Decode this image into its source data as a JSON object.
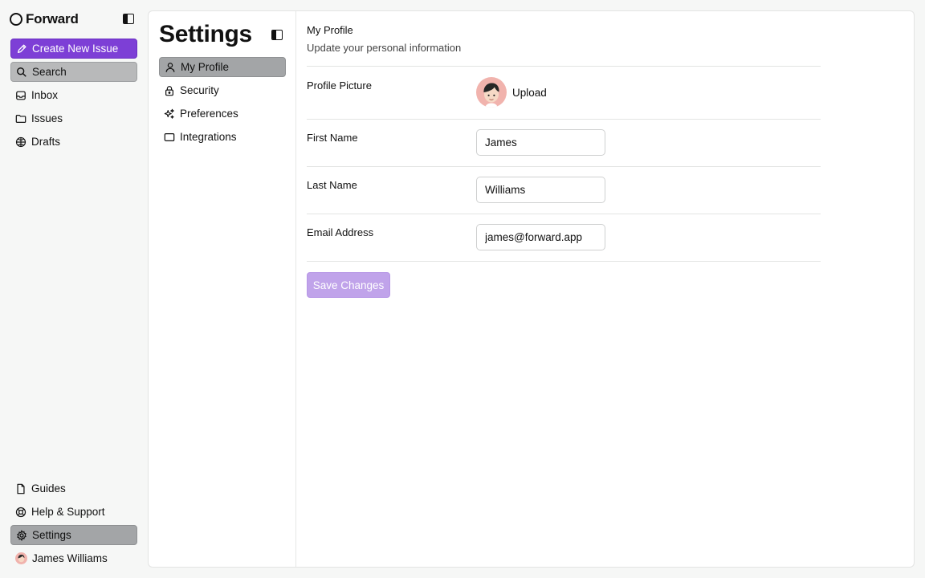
{
  "app": {
    "name": "Forward"
  },
  "sidebar": {
    "create_label": "Create New Issue",
    "items": [
      {
        "label": "Search",
        "icon": "search-icon"
      },
      {
        "label": "Inbox",
        "icon": "inbox-icon"
      },
      {
        "label": "Issues",
        "icon": "folder-icon"
      },
      {
        "label": "Drafts",
        "icon": "drafts-icon"
      }
    ],
    "bottom_items": [
      {
        "label": "Guides",
        "icon": "document-icon"
      },
      {
        "label": "Help & Support",
        "icon": "lifebuoy-icon"
      },
      {
        "label": "Settings",
        "icon": "gear-icon"
      }
    ],
    "user": {
      "name": "James Williams"
    }
  },
  "settings": {
    "title": "Settings",
    "nav": [
      {
        "label": "My Profile",
        "icon": "user-icon"
      },
      {
        "label": "Security",
        "icon": "lock-icon"
      },
      {
        "label": "Preferences",
        "icon": "sparkles-icon"
      },
      {
        "label": "Integrations",
        "icon": "window-icon"
      }
    ]
  },
  "profile": {
    "title": "My Profile",
    "subtitle": "Update your personal information",
    "picture_label": "Profile Picture",
    "upload_label": "Upload",
    "first_name_label": "First Name",
    "first_name_value": "James",
    "last_name_label": "Last Name",
    "last_name_value": "Williams",
    "email_label": "Email Address",
    "email_value": "james@forward.app",
    "save_label": "Save Changes"
  },
  "colors": {
    "accent": "#7d3fd6",
    "save_disabled": "#c0a3ea",
    "avatar_bg": "#f1b3ad"
  }
}
